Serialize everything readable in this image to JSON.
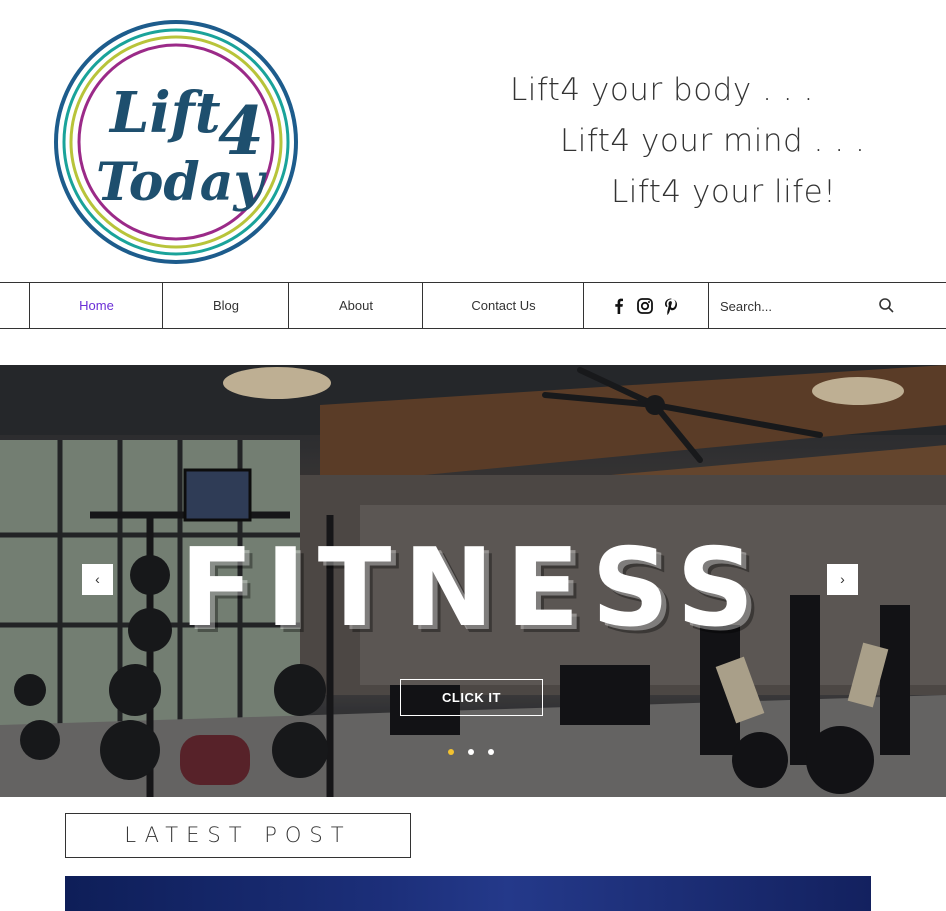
{
  "header": {
    "logo": {
      "line1": "Lift",
      "numeral": "4",
      "line2": "Today",
      "colors": {
        "ink": "#1e4f6e",
        "purple": "#9b2a88",
        "lime": "#b8c43a",
        "teal": "#1aa39a",
        "blue": "#1d5c8c"
      }
    },
    "taglines": [
      "Lift4 your body . . .",
      "Lift4 your mind . . .",
      "Lift4 your life!"
    ]
  },
  "nav": {
    "items": [
      {
        "label": "Home",
        "active": true
      },
      {
        "label": "Blog",
        "active": false
      },
      {
        "label": "About",
        "active": false
      },
      {
        "label": "Contact Us",
        "active": false
      }
    ],
    "social_icons": [
      "facebook-icon",
      "instagram-icon",
      "pinterest-icon"
    ],
    "search": {
      "placeholder": "Search...",
      "value": ""
    },
    "active_color": "#6b2fd6"
  },
  "hero": {
    "title": "FITNESS",
    "button_label": "CLICK IT",
    "prev_arrow": "‹",
    "next_arrow": "›",
    "slides_total": 3,
    "active_slide": 1,
    "dot_active_color": "#f2c230"
  },
  "latest_post": {
    "heading": "LATEST POST"
  }
}
